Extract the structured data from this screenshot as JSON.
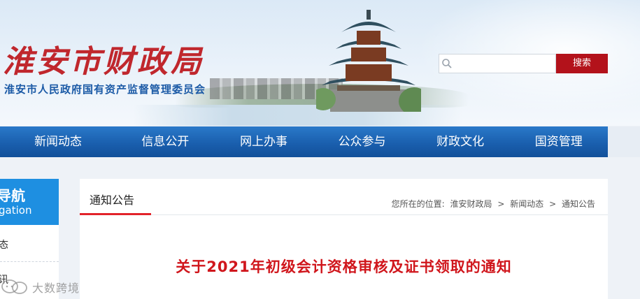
{
  "header": {
    "logo": "淮安市财政局",
    "subtitle": "淮安市人民政府国有资产监督管理委员会"
  },
  "search": {
    "placeholder": "",
    "button_label": "搜索"
  },
  "nav": {
    "items": [
      "新闻动态",
      "信息公开",
      "网上办事",
      "公众参与",
      "财政文化",
      "国资管理"
    ]
  },
  "sidebar": {
    "head_title": "导航",
    "head_subtitle": "gation",
    "items": [
      "态",
      "讯"
    ]
  },
  "main": {
    "tab_title": "通知公告",
    "breadcrumb": {
      "prefix": "您所在的位置:",
      "items": [
        "淮安财政局",
        "新闻动态",
        "通知公告"
      ],
      "separator": ">"
    },
    "article_title": "关于2021年初级会计资格审核及证书领取的通知"
  },
  "watermark": {
    "text": "大数跨境"
  },
  "colors": {
    "brand_red": "#c0272d",
    "nav_blue": "#1a5fae",
    "side_blue": "#1e8fe1",
    "title_red": "#d0161c"
  }
}
